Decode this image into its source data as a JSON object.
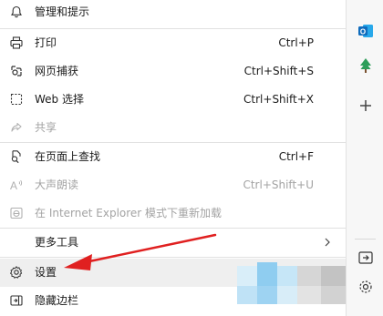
{
  "menu": {
    "top_item": {
      "label": "管理和提示",
      "icon": "bell-icon"
    },
    "items": [
      {
        "label": "打印",
        "shortcut": "Ctrl+P",
        "icon": "printer-icon",
        "disabled": false
      },
      {
        "label": "网页捕获",
        "shortcut": "Ctrl+Shift+S",
        "icon": "web-capture-icon",
        "disabled": false
      },
      {
        "label": "Web 选择",
        "shortcut": "Ctrl+Shift+X",
        "icon": "web-select-icon",
        "disabled": false
      },
      {
        "label": "共享",
        "shortcut": "",
        "icon": "share-icon",
        "disabled": true
      },
      {
        "label": "在页面上查找",
        "shortcut": "Ctrl+F",
        "icon": "find-icon",
        "disabled": false
      },
      {
        "label": "大声朗读",
        "shortcut": "Ctrl+Shift+U",
        "icon": "read-aloud-icon",
        "disabled": true
      },
      {
        "label": "在 Internet Explorer 模式下重新加载",
        "shortcut": "",
        "icon": "ie-icon",
        "disabled": true
      },
      {
        "label": "更多工具",
        "shortcut": "",
        "icon": "chevron-right-icon",
        "disabled": false
      },
      {
        "label": "设置",
        "shortcut": "",
        "icon": "gear-icon",
        "disabled": false
      },
      {
        "label": "隐藏边栏",
        "shortcut": "",
        "icon": "sidebar-icon",
        "disabled": false
      }
    ]
  },
  "annotation": {
    "color": "#e02020",
    "icon": "red-arrow"
  },
  "sidebar": {
    "icons": [
      "outlook-icon",
      "tree-icon",
      "plus-icon",
      "exit-sidebar-icon",
      "settings-icon"
    ],
    "accent": "#0f6cbd"
  }
}
